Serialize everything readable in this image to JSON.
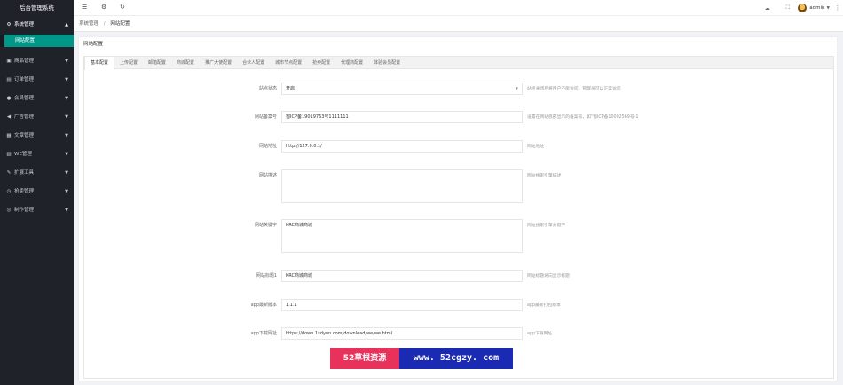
{
  "app": {
    "title": "后台管理系统"
  },
  "sidebar": {
    "items": [
      {
        "label": "系统管理",
        "icon": "gear-icon",
        "arrow": "▲",
        "open": true
      },
      {
        "label": "商品管理",
        "icon": "box-icon",
        "arrow": "▼"
      },
      {
        "label": "订单管理",
        "icon": "order-icon",
        "arrow": "▼"
      },
      {
        "label": "会员管理",
        "icon": "user-icon",
        "arrow": "▼"
      },
      {
        "label": "广告管理",
        "icon": "megaphone-icon",
        "arrow": "▼"
      },
      {
        "label": "文章管理",
        "icon": "article-icon",
        "arrow": "▼"
      },
      {
        "label": "WE管理",
        "icon": "we-icon",
        "arrow": "▼"
      },
      {
        "label": "扩展工具",
        "icon": "wrench-icon",
        "arrow": "▼"
      },
      {
        "label": "抢卖管理",
        "icon": "clock-icon",
        "arrow": "▼"
      },
      {
        "label": "制作管理",
        "icon": "target-icon",
        "arrow": "▼"
      }
    ],
    "active_sub": "网站配置"
  },
  "header": {
    "icons": [
      "menu-icon",
      "settings-icon",
      "refresh-icon"
    ],
    "right_icons": [
      "cloud-icon",
      "fullscreen-icon"
    ],
    "user": "admin",
    "caret": "▼",
    "more": "⋮"
  },
  "breadcrumb": {
    "parent": "系统管理",
    "sep": "/",
    "current": "网站配置"
  },
  "card": {
    "title": "网站配置",
    "tabs": [
      "基本配置",
      "上传配置",
      "邮箱配置",
      "商城配置",
      "推广大使配置",
      "合伙人配置",
      "城市节点配置",
      "抢卖配置",
      "代理商配置",
      "体验会员配置"
    ],
    "active_tab": 0
  },
  "form": {
    "site_status": {
      "label": "站点状态",
      "value": "开启",
      "hint": "站点关闭后将用户不能访问，管理员可以正常访问"
    },
    "icp": {
      "label": "网站备案号",
      "value": "蜀ICP备19019763号1111111",
      "hint": "设置在网站底部显示的备案号，如\"蜀ICP备10002569号-1"
    },
    "url": {
      "label": "网站地址",
      "value": "http://127.0.0.1/",
      "hint": "网站地址"
    },
    "desc": {
      "label": "网站描述",
      "value": "",
      "hint": "网站搜索引擎描述"
    },
    "keywords": {
      "label": "网站关键字",
      "value": "KRC商城商城",
      "hint": "网站搜索引擎关键字"
    },
    "title": {
      "label": "网站标题1",
      "value": "KRC商城商城",
      "hint": "网站标题将向显示标题"
    },
    "app_version": {
      "label": "app最新版本",
      "value": "1.1.1",
      "hint": "app最新打包版本"
    },
    "app_download": {
      "label": "app下载网址",
      "value": "https://down.1sdyun.com/download/we/we.html",
      "hint": "app下载网址"
    }
  },
  "watermark": {
    "left": "52草根资源",
    "right": "www. 52cgzy. com"
  },
  "colors": {
    "sidebar": "#20222a",
    "accent": "#009688",
    "watermark_left": "#e8325b",
    "watermark_right": "#1a2ab3"
  }
}
